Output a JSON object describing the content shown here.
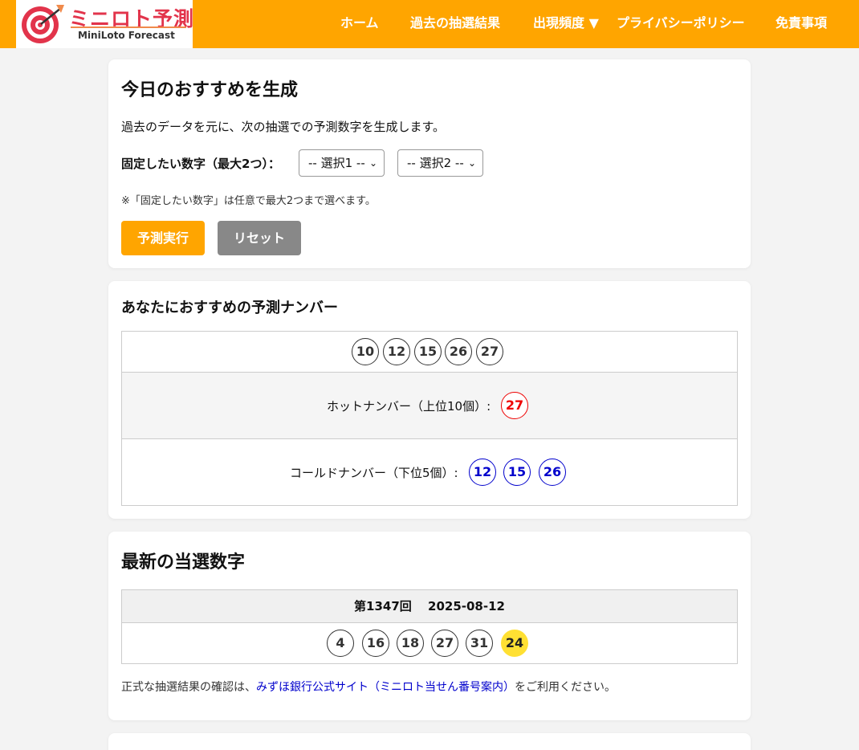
{
  "header": {
    "logo_title": "ミニロト予測",
    "logo_subtitle": "MiniLoto Forecast",
    "nav": [
      "ホーム",
      "過去の抽選結果",
      "出現頻度 ▼",
      "プライバシーポリシー",
      "免責事項"
    ]
  },
  "generate": {
    "title": "今日のおすすめを生成",
    "description": "過去のデータを元に、次の抽選での予測数字を生成します。",
    "fixed_label": "固定したい数字（最大2つ）：",
    "select1": "-- 選択1 --",
    "select2": "-- 選択2 --",
    "note": "※「固定したい数字」は任意で最大2つまで選べます。",
    "run_button": "予測実行",
    "reset_button": "リセット"
  },
  "prediction": {
    "title": "あなたにおすすめの予測ナンバー",
    "numbers": [
      "10",
      "12",
      "15",
      "26",
      "27"
    ],
    "hot_label": "ホットナンバー（上位10個）:",
    "hot_numbers": [
      "27"
    ],
    "cold_label": "コールドナンバー（下位5個）:",
    "cold_numbers": [
      "12",
      "15",
      "26"
    ]
  },
  "latest": {
    "title": "最新の当選数字",
    "draw_header": "第1347回　 2025-08-12",
    "numbers": [
      "4",
      "16",
      "18",
      "27",
      "31"
    ],
    "bonus": "24",
    "note_prefix": "正式な抽選結果の確認は、",
    "link_text": "みずほ銀行公式サイト（ミニロト当せん番号案内）",
    "note_suffix": "をご利用ください。"
  },
  "colors": {
    "brand": "#ffa500",
    "hot": "#ee0000",
    "cold": "#0000cc",
    "bonus": "#ffe033",
    "reset": "#888888"
  }
}
